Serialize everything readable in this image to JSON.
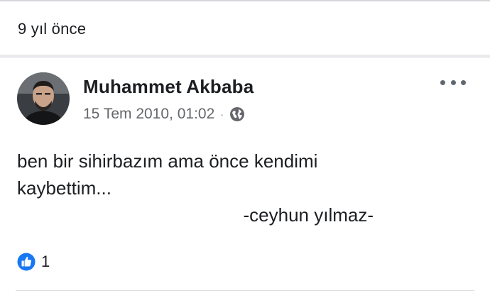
{
  "memory": {
    "time_ago": "9 yıl önce"
  },
  "post": {
    "author": "Muhammet Akbaba",
    "date": "15 Tem 2010, 01:02",
    "separator": "·",
    "privacy_icon": "globe-icon",
    "text_line1": "ben bir sihirbazım ama önce kendimi",
    "text_line2": "kaybettim...",
    "text_signature": "-ceyhun yılmaz-",
    "reaction_icon": "like-icon",
    "reaction_count": "1"
  },
  "colors": {
    "background": "#e9ebee",
    "card": "#ffffff",
    "secondary_text": "#65676b",
    "like_blue": "#1877f2"
  }
}
